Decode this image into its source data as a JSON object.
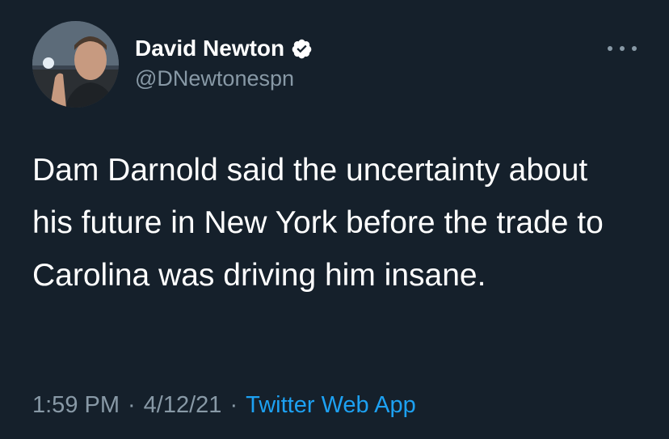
{
  "tweet": {
    "author": {
      "display_name": "David Newton",
      "handle": "@DNewtonespn",
      "verified": true
    },
    "text": "Dam Darnold said the uncertainty about his future in New York before the trade to Carolina was driving him insane.",
    "meta": {
      "time": "1:59 PM",
      "separator": "·",
      "date": "4/12/21",
      "source": "Twitter Web App"
    },
    "icons": {
      "verified": "verified-badge-icon",
      "more": "more-options-icon"
    }
  },
  "colors": {
    "background": "#15202b",
    "primary_text": "#ffffff",
    "secondary_text": "#8899a6",
    "link": "#1da1f2"
  }
}
